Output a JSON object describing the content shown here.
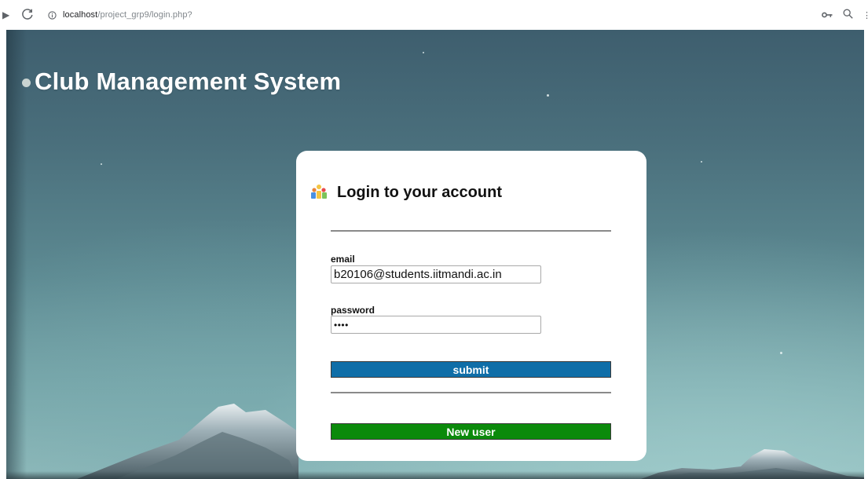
{
  "browser": {
    "url_host": "localhost",
    "url_path": "/project_grp9/login.php?",
    "icons": [
      "forward-icon",
      "reload-icon",
      "info-icon",
      "key-icon",
      "zoom-icon"
    ]
  },
  "header": {
    "title": "Club Management System"
  },
  "login": {
    "heading": "Login to your account",
    "email_label": "email",
    "email_value": "b20106@students.iitmandi.ac.in",
    "password_label": "password",
    "password_value": "••••",
    "submit_label": "submit",
    "new_user_label": "New user"
  },
  "colors": {
    "submit_button": "#0f6ea8",
    "new_user_button": "#0b8a0b",
    "card": "#ffffff"
  }
}
